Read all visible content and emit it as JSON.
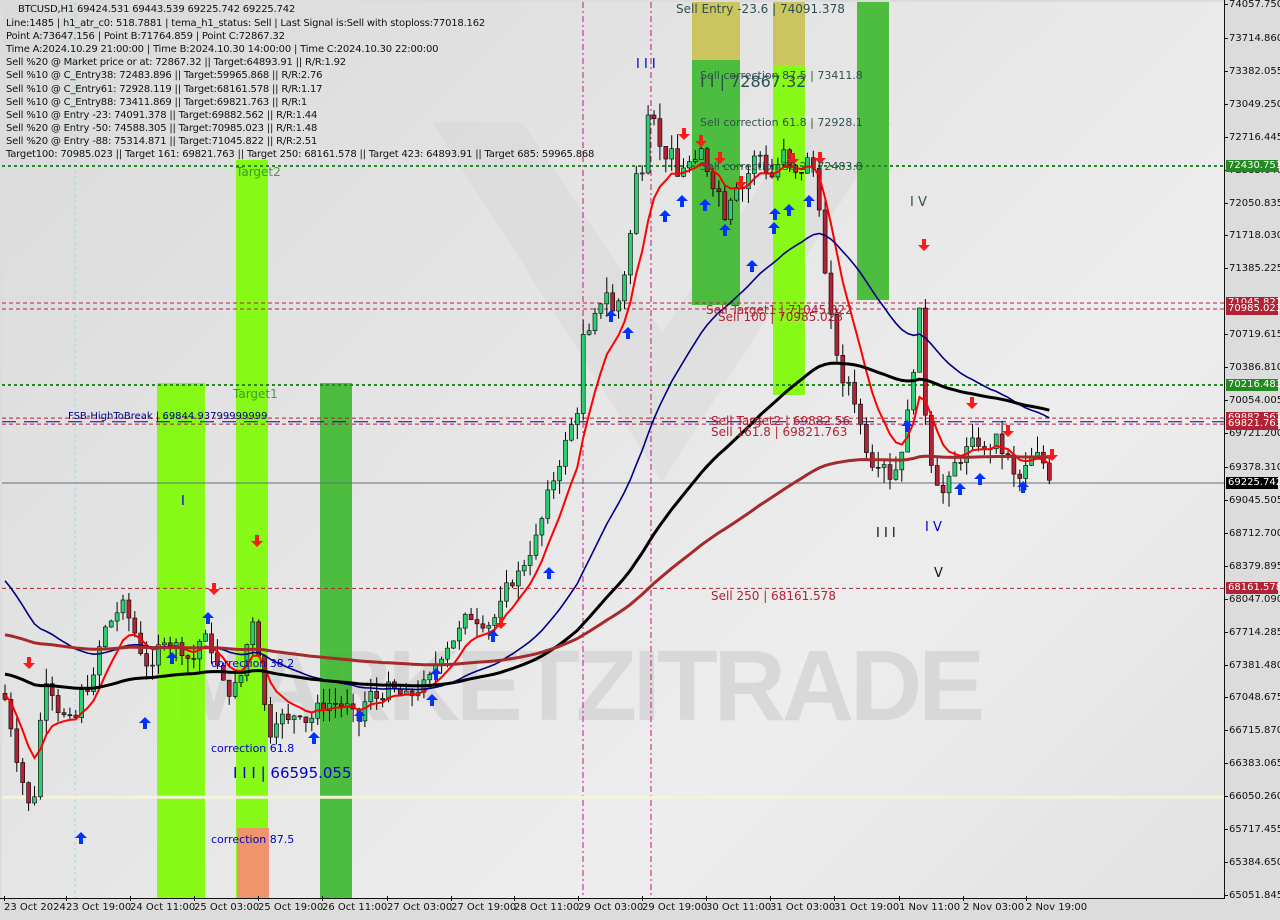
{
  "window": {
    "symbol_header": "BTCUSD,H1  69424.531 69443.539 69225.742 69225.742"
  },
  "info_lines": [
    "Line:1485 | h1_atr_c0: 518.7881 | tema_h1_status: Sell | Last Signal is:Sell with stoploss:77018.162",
    "Point A:73647.156 | Point B:71764.859 | Point C:72867.32",
    "Time A:2024.10.29 21:00:00 | Time B:2024.10.30 14:00:00 | Time C:2024.10.30 22:00:00",
    "Sell %20 @ Market price or at: 72867.32 || Target:64893.91 || R/R:1.92",
    "Sell %10 @ C_Entry38: 72483.896 || Target:59965.868 || R/R:2.76",
    "Sell %10 @ C_Entry61: 72928.119 || Target:68161.578 || R/R:1.17",
    "Sell %10 @ C_Entry88: 73411.869 || Target:69821.763 || R/R:1",
    "Sell %10 @ Entry -23: 74091.378 || Target:69882.562 || R/R:1.44",
    "Sell %20 @ Entry -50: 74588.305 || Target:70985.023 || R/R:1.48",
    "Sell %20 @ Entry -88: 75314.871 || Target:71045.822 || R/R:2.51",
    "Target100: 70985.023 || Target 161: 69821.763 || Target 250: 68161.578 || Target 423: 64893.91 || Target 685: 59965.868"
  ],
  "colors": {
    "bull": "#2ecc71",
    "bear": "#b22234",
    "ema_fast": "#ff0000",
    "ema_mid": "#000080",
    "ema_slow": "#000000",
    "ema_200": "#a52a2a",
    "target_green": "#228b22",
    "target_red": "#b22234",
    "current_price_box": "#000000",
    "zone_lime": "#7cfc00",
    "zone_green": "#3cb82c",
    "zone_olive": "#c8c050",
    "zone_salmon": "#fa8a78",
    "vline": "#c71585"
  },
  "chart_data": {
    "type": "candlestick",
    "title": "BTCUSD,H1",
    "ohlc_last": {
      "open": 69424.531,
      "high": 69443.539,
      "low": 69225.742,
      "close": 69225.742
    },
    "ylim": [
      65051.845,
      74057.75
    ],
    "y_ticks": [
      "74057.750",
      "73714.860",
      "73382.055",
      "73049.250",
      "72716.445",
      "72383.640",
      "72050.835",
      "71718.030",
      "71385.225",
      "70719.615",
      "70386.810",
      "70054.005",
      "69721.200",
      "69378.310",
      "69045.505",
      "68712.700",
      "68379.895",
      "68047.090",
      "67714.285",
      "67381.480",
      "67048.675",
      "66715.870",
      "66383.065",
      "66050.260",
      "65717.455",
      "65384.650",
      "65051.845"
    ],
    "x_ticks": [
      "23 Oct 2024",
      "23 Oct 19:00",
      "24 Oct 11:00",
      "25 Oct 03:00",
      "25 Oct 19:00",
      "26 Oct 11:00",
      "27 Oct 03:00",
      "27 Oct 19:00",
      "28 Oct 11:00",
      "29 Oct 03:00",
      "29 Oct 19:00",
      "30 Oct 11:00",
      "31 Oct 03:00",
      "31 Oct 19:00",
      "1 Nov 11:00",
      "2 Nov 03:00",
      "2 Nov 19:00"
    ],
    "price_labels": [
      {
        "value": 72430.751,
        "text": "72430.751",
        "color": "#228b22"
      },
      {
        "value": 71045.822,
        "text": "71045.822",
        "color": "#b22234"
      },
      {
        "value": 70985.023,
        "text": "70985.023",
        "color": "#b22234"
      },
      {
        "value": 70216.483,
        "text": "70216.483",
        "color": "#228b22"
      },
      {
        "value": 69882.562,
        "text": "69882.562",
        "color": "#b22234"
      },
      {
        "value": 69821.763,
        "text": "69821.763",
        "color": "#b22234"
      },
      {
        "value": 69225.742,
        "text": "69225.742",
        "color": "#000000"
      },
      {
        "value": 68161.578,
        "text": "68161.578",
        "color": "#b22234"
      }
    ],
    "hlines": [
      {
        "value": 72430.751,
        "style": "dotted-green"
      },
      {
        "value": 71045.822,
        "style": "dashed-red"
      },
      {
        "value": 70985.023,
        "style": "dashed-red"
      },
      {
        "value": 70216.483,
        "style": "dotted-green"
      },
      {
        "value": 69882.562,
        "style": "dashed-red"
      },
      {
        "value": 69844.938,
        "style": "dashed-blue"
      },
      {
        "value": 69821.763,
        "style": "dashed-red"
      },
      {
        "value": 69225.742,
        "style": "solid-gray"
      },
      {
        "value": 68161.578,
        "style": "dashed-red"
      },
      {
        "value": 66050.26,
        "style": "solid-cream"
      }
    ],
    "annotations": [
      {
        "text": "Sell Entry -23.6 | 74091.378",
        "price": 74091.378,
        "color": "#2f4f4f"
      },
      {
        "text": "Sell correction 87.5 | 73411.8",
        "price": 73411.8,
        "color": "#2f4f4f"
      },
      {
        "text": "I I | 72867.32",
        "price": 73300,
        "color": "#2f4f4f"
      },
      {
        "text": "Sell correction 61.8 | 72928.1",
        "price": 72928.1,
        "color": "#2f4f4f"
      },
      {
        "text": "Sell correction 38.2 | 72483.8",
        "price": 72483.8,
        "color": "#2f4f4f"
      },
      {
        "text": "Sell Target1 | 71045.822",
        "price": 71045.822,
        "color": "#b22234"
      },
      {
        "text": "Sell 100 | 70985.023",
        "price": 70985.023,
        "color": "#b22234"
      },
      {
        "text": "Sell Target2 | 69882.56",
        "price": 69882.562,
        "color": "#b22234"
      },
      {
        "text": "Sell 161.8 | 69821.763",
        "price": 69821.763,
        "color": "#b22234"
      },
      {
        "text": "Sell 250 | 68161.578",
        "price": 68161.578,
        "color": "#b22234"
      },
      {
        "text": "FSB-HighToBreak | 69844.93799999999",
        "price": 69844.938,
        "color": "#000080"
      },
      {
        "text": "Target2",
        "price": 72430.751,
        "color": "#228b22"
      },
      {
        "text": "Target1",
        "price": 70216.483,
        "color": "#228b22"
      },
      {
        "text": "correction 38.2",
        "price": 67400,
        "color": "#0000cd"
      },
      {
        "text": "correction 61.8",
        "price": 66720,
        "color": "#0000cd"
      },
      {
        "text": "I I I | 66595.055",
        "price": 66595.055,
        "color": "#0000cd"
      },
      {
        "text": "correction 87.5",
        "price": 65750,
        "color": "#0000cd"
      },
      {
        "text": "I",
        "price": 69000,
        "color": "#0000cd"
      },
      {
        "text": "I I I",
        "price": 73500,
        "color": "#0000cd"
      },
      {
        "text": "I V",
        "price": 72050,
        "color": "#2f4f4f"
      },
      {
        "text": "I I I",
        "price": 68750,
        "color": "#111111"
      },
      {
        "text": "I V",
        "price": 68800,
        "color": "#0000cd"
      },
      {
        "text": "V",
        "price": 68400,
        "color": "#111111"
      }
    ],
    "watermark": "MARKETZITRADE",
    "series": [
      {
        "name": "EMA fast",
        "color": "#ff0000"
      },
      {
        "name": "EMA mid",
        "color": "#000080"
      },
      {
        "name": "EMA slow",
        "color": "#000000"
      },
      {
        "name": "EMA 200",
        "color": "#a52a2a"
      }
    ],
    "price_path": [
      [
        0,
        67100
      ],
      [
        5,
        67000
      ],
      [
        12,
        66600
      ],
      [
        18,
        66300
      ],
      [
        24,
        66100
      ],
      [
        30,
        65800
      ],
      [
        36,
        66500
      ],
      [
        42,
        67300
      ],
      [
        48,
        67200
      ],
      [
        56,
        66950
      ],
      [
        66,
        66800
      ],
      [
        74,
        66850
      ],
      [
        82,
        67200
      ],
      [
        90,
        67150
      ],
      [
        100,
        67700
      ],
      [
        110,
        67850
      ],
      [
        120,
        68000
      ],
      [
        130,
        67800
      ],
      [
        140,
        67500
      ],
      [
        150,
        67300
      ],
      [
        160,
        67700
      ],
      [
        170,
        67600
      ],
      [
        180,
        67550
      ],
      [
        190,
        67400
      ],
      [
        200,
        67700
      ],
      [
        210,
        67550
      ],
      [
        220,
        67200
      ],
      [
        230,
        67100
      ],
      [
        240,
        67300
      ],
      [
        250,
        67900
      ],
      [
        256,
        67600
      ],
      [
        262,
        67000
      ],
      [
        268,
        66700
      ],
      [
        276,
        66900
      ],
      [
        286,
        66800
      ],
      [
        296,
        66950
      ],
      [
        306,
        66800
      ],
      [
        316,
        66950
      ],
      [
        326,
        67000
      ],
      [
        336,
        67000
      ],
      [
        346,
        66950
      ],
      [
        356,
        66800
      ],
      [
        366,
        67100
      ],
      [
        376,
        67050
      ],
      [
        386,
        67150
      ],
      [
        396,
        67100
      ],
      [
        406,
        67050
      ],
      [
        416,
        67150
      ],
      [
        426,
        67200
      ],
      [
        436,
        67450
      ],
      [
        446,
        67600
      ],
      [
        456,
        67700
      ],
      [
        466,
        67900
      ],
      [
        476,
        67850
      ],
      [
        486,
        67800
      ],
      [
        496,
        67900
      ],
      [
        506,
        68200
      ],
      [
        516,
        68300
      ],
      [
        526,
        68500
      ],
      [
        536,
        68700
      ],
      [
        546,
        69100
      ],
      [
        556,
        69400
      ],
      [
        566,
        69700
      ],
      [
        576,
        70000
      ],
      [
        582,
        70800
      ],
      [
        588,
        70700
      ],
      [
        596,
        71000
      ],
      [
        604,
        71200
      ],
      [
        612,
        70900
      ],
      [
        620,
        71200
      ],
      [
        628,
        71700
      ],
      [
        636,
        72500
      ],
      [
        642,
        72400
      ],
      [
        648,
        73300
      ],
      [
        654,
        72800
      ],
      [
        660,
        72500
      ],
      [
        668,
        72600
      ],
      [
        676,
        72300
      ],
      [
        684,
        72500
      ],
      [
        692,
        72400
      ],
      [
        700,
        72600
      ],
      [
        708,
        72300
      ],
      [
        716,
        72200
      ],
      [
        724,
        71900
      ],
      [
        732,
        72300
      ],
      [
        740,
        72200
      ],
      [
        748,
        72400
      ],
      [
        756,
        72600
      ],
      [
        764,
        72400
      ],
      [
        772,
        72300
      ],
      [
        780,
        72600
      ],
      [
        788,
        72400
      ],
      [
        796,
        72300
      ],
      [
        804,
        72500
      ],
      [
        812,
        72400
      ],
      [
        818,
        72000
      ],
      [
        824,
        71200
      ],
      [
        830,
        70800
      ],
      [
        836,
        70500
      ],
      [
        842,
        70100
      ],
      [
        848,
        70300
      ],
      [
        856,
        69900
      ],
      [
        864,
        69600
      ],
      [
        872,
        69400
      ],
      [
        880,
        69500
      ],
      [
        888,
        69300
      ],
      [
        896,
        69400
      ],
      [
        904,
        69800
      ],
      [
        910,
        70200
      ],
      [
        916,
        71000
      ],
      [
        920,
        70800
      ],
      [
        924,
        69800
      ],
      [
        928,
        69500
      ],
      [
        934,
        69300
      ],
      [
        940,
        69100
      ],
      [
        946,
        69200
      ],
      [
        952,
        69400
      ],
      [
        960,
        69500
      ],
      [
        968,
        69600
      ],
      [
        976,
        69650
      ],
      [
        984,
        69500
      ],
      [
        992,
        69700
      ],
      [
        1000,
        69550
      ],
      [
        1008,
        69450
      ],
      [
        1014,
        69200
      ],
      [
        1020,
        69300
      ],
      [
        1028,
        69450
      ],
      [
        1036,
        69500
      ],
      [
        1044,
        69400
      ],
      [
        1050,
        69225
      ]
    ]
  }
}
